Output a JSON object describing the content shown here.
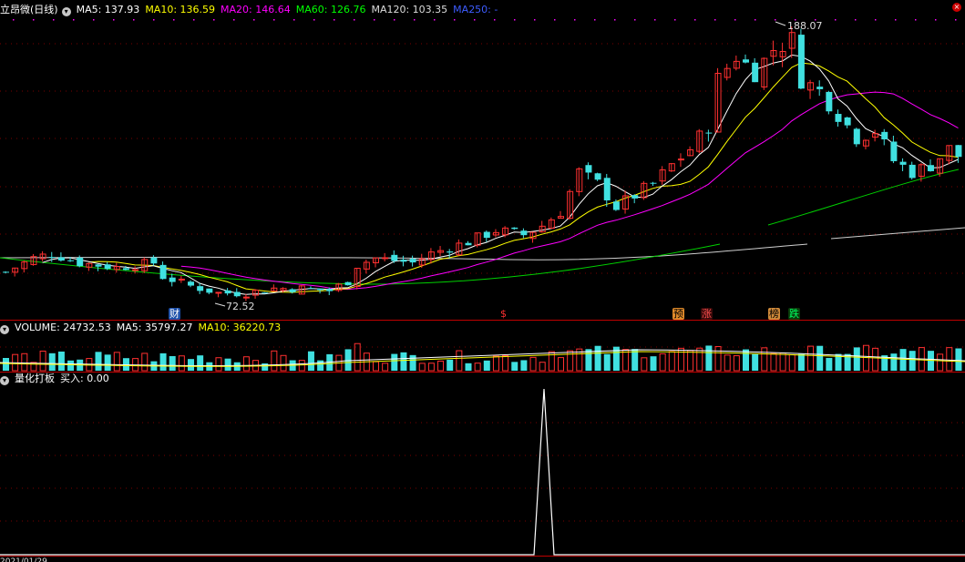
{
  "main_header": {
    "title": "立昂微(日线)",
    "items": [
      {
        "label": "MA5: 137.93",
        "color": "#ffffff"
      },
      {
        "label": "MA10: 136.59",
        "color": "#ffff00"
      },
      {
        "label": "MA20: 146.64",
        "color": "#ff00ff"
      },
      {
        "label": "MA60: 126.76",
        "color": "#00ff00"
      },
      {
        "label": "MA120: 103.35",
        "color": "#dcdcdc"
      },
      {
        "label": "MA250: -",
        "color": "#3d5cff"
      }
    ]
  },
  "price_annotations": {
    "high": "188.07",
    "low": "72.52"
  },
  "event_tags": [
    {
      "text": "财",
      "fg": "#ffffff",
      "bg": "#1d4fa8"
    },
    {
      "text": "$",
      "fg": "#ff3030",
      "bg": "transparent"
    },
    {
      "text": "预",
      "fg": "#000000",
      "bg": "#e08a2a"
    },
    {
      "text": "涨",
      "fg": "#ff5050",
      "bg": "#3a0a0a"
    },
    {
      "text": "榜",
      "fg": "#000000",
      "bg": "#d08a3a"
    },
    {
      "text": "跌",
      "fg": "#00ff60",
      "bg": "#0a3a0a"
    }
  ],
  "volume_header": {
    "items": [
      {
        "label": "VOLUME: 24732.53",
        "color": "#ffffff"
      },
      {
        "label": "MA5: 35797.27",
        "color": "#ffffff"
      },
      {
        "label": "MA10: 36220.73",
        "color": "#ffff00"
      }
    ]
  },
  "indicator_header": {
    "items": [
      {
        "label": "量化打板",
        "color": "#ffffff"
      },
      {
        "label": "买入: 0.00",
        "color": "#ffffff"
      }
    ]
  },
  "bottom_date": "2021/01/29"
}
